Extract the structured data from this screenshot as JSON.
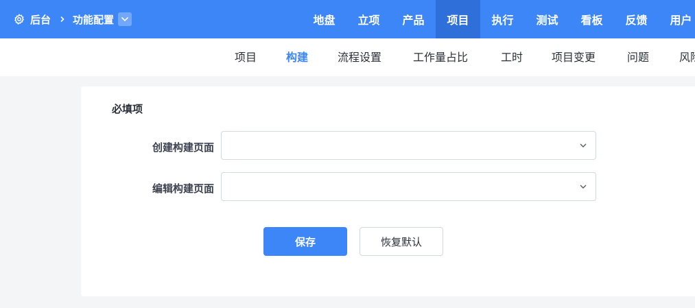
{
  "header": {
    "breadcrumb": {
      "root": "后台",
      "current": "功能配置"
    },
    "nav": [
      "地盘",
      "立项",
      "产品",
      "项目",
      "执行",
      "测试",
      "看板",
      "反馈",
      "用户"
    ],
    "active_nav": "项目"
  },
  "subnav": {
    "items": [
      "项目",
      "构建",
      "流程设置",
      "工作量占比",
      "工时",
      "项目变更",
      "问题",
      "风险"
    ],
    "active": "构建"
  },
  "form": {
    "section_title": "必填项",
    "fields": [
      {
        "label": "创建构建页面",
        "value": ""
      },
      {
        "label": "编辑构建页面",
        "value": ""
      }
    ],
    "save_label": "保存",
    "reset_label": "恢复默认"
  },
  "colors": {
    "primary": "#3d86f7",
    "primary_active": "#2f6fd9",
    "background": "#f4f5f7"
  },
  "icons": {
    "settings": "gear-icon",
    "separator": "chevron-right-icon",
    "dropdown": "chevron-down-icon"
  }
}
